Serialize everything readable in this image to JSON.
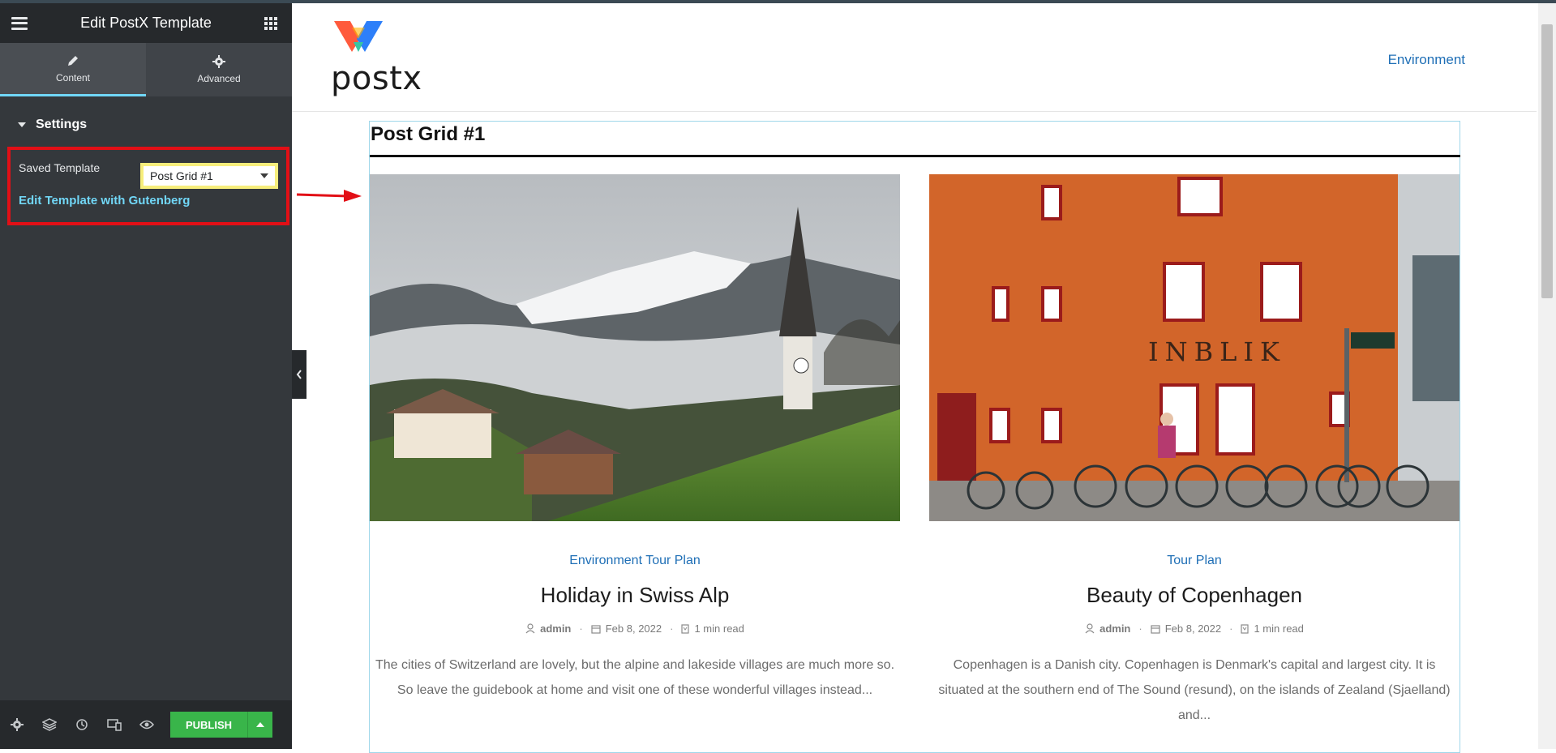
{
  "panel": {
    "title": "Edit PostX Template",
    "tabs": [
      {
        "label": "Content",
        "icon": "pencil-icon",
        "active": true
      },
      {
        "label": "Advanced",
        "icon": "gear-icon",
        "active": false
      }
    ],
    "section_title": "Settings",
    "saved_template_label": "Saved Template",
    "saved_template_value": "Post Grid #1",
    "edit_link": "Edit Template with Gutenberg",
    "footer": {
      "icons": [
        "settings-icon",
        "layers-icon",
        "history-icon",
        "responsive-icon",
        "preview-eye-icon"
      ],
      "publish_label": "PUBLISH"
    }
  },
  "site": {
    "logo_text": "postx",
    "nav_item": "Environment"
  },
  "grid": {
    "title": "Post Grid #1",
    "posts": [
      {
        "categories": [
          "Environment",
          "Tour Plan"
        ],
        "title": "Holiday in Swiss Alp",
        "author": "admin",
        "date": "Feb 8, 2022",
        "read_time": "1 min read",
        "excerpt": "The cities of Switzerland are lovely, but the alpine and lakeside villages are much more so. So leave the guidebook at home and visit one of these wonderful villages instead..."
      },
      {
        "categories": [
          "Tour Plan"
        ],
        "title": "Beauty of Copenhagen",
        "author": "admin",
        "date": "Feb 8, 2022",
        "read_time": "1 min read",
        "excerpt": "Copenhagen is a Danish city. Copenhagen is Denmark's capital and largest city. It is situated at the southern end of The Sound (resund), on the islands of Zealand (Sjaelland) and..."
      }
    ]
  },
  "colors": {
    "panel_bg": "#34383c",
    "panel_header": "#26292c",
    "accent_cyan": "#71d7f7",
    "highlight_red": "#e20f16",
    "highlight_yellow": "#f7ee7c",
    "publish_green": "#39b54a",
    "link_blue": "#1f6fb6"
  }
}
